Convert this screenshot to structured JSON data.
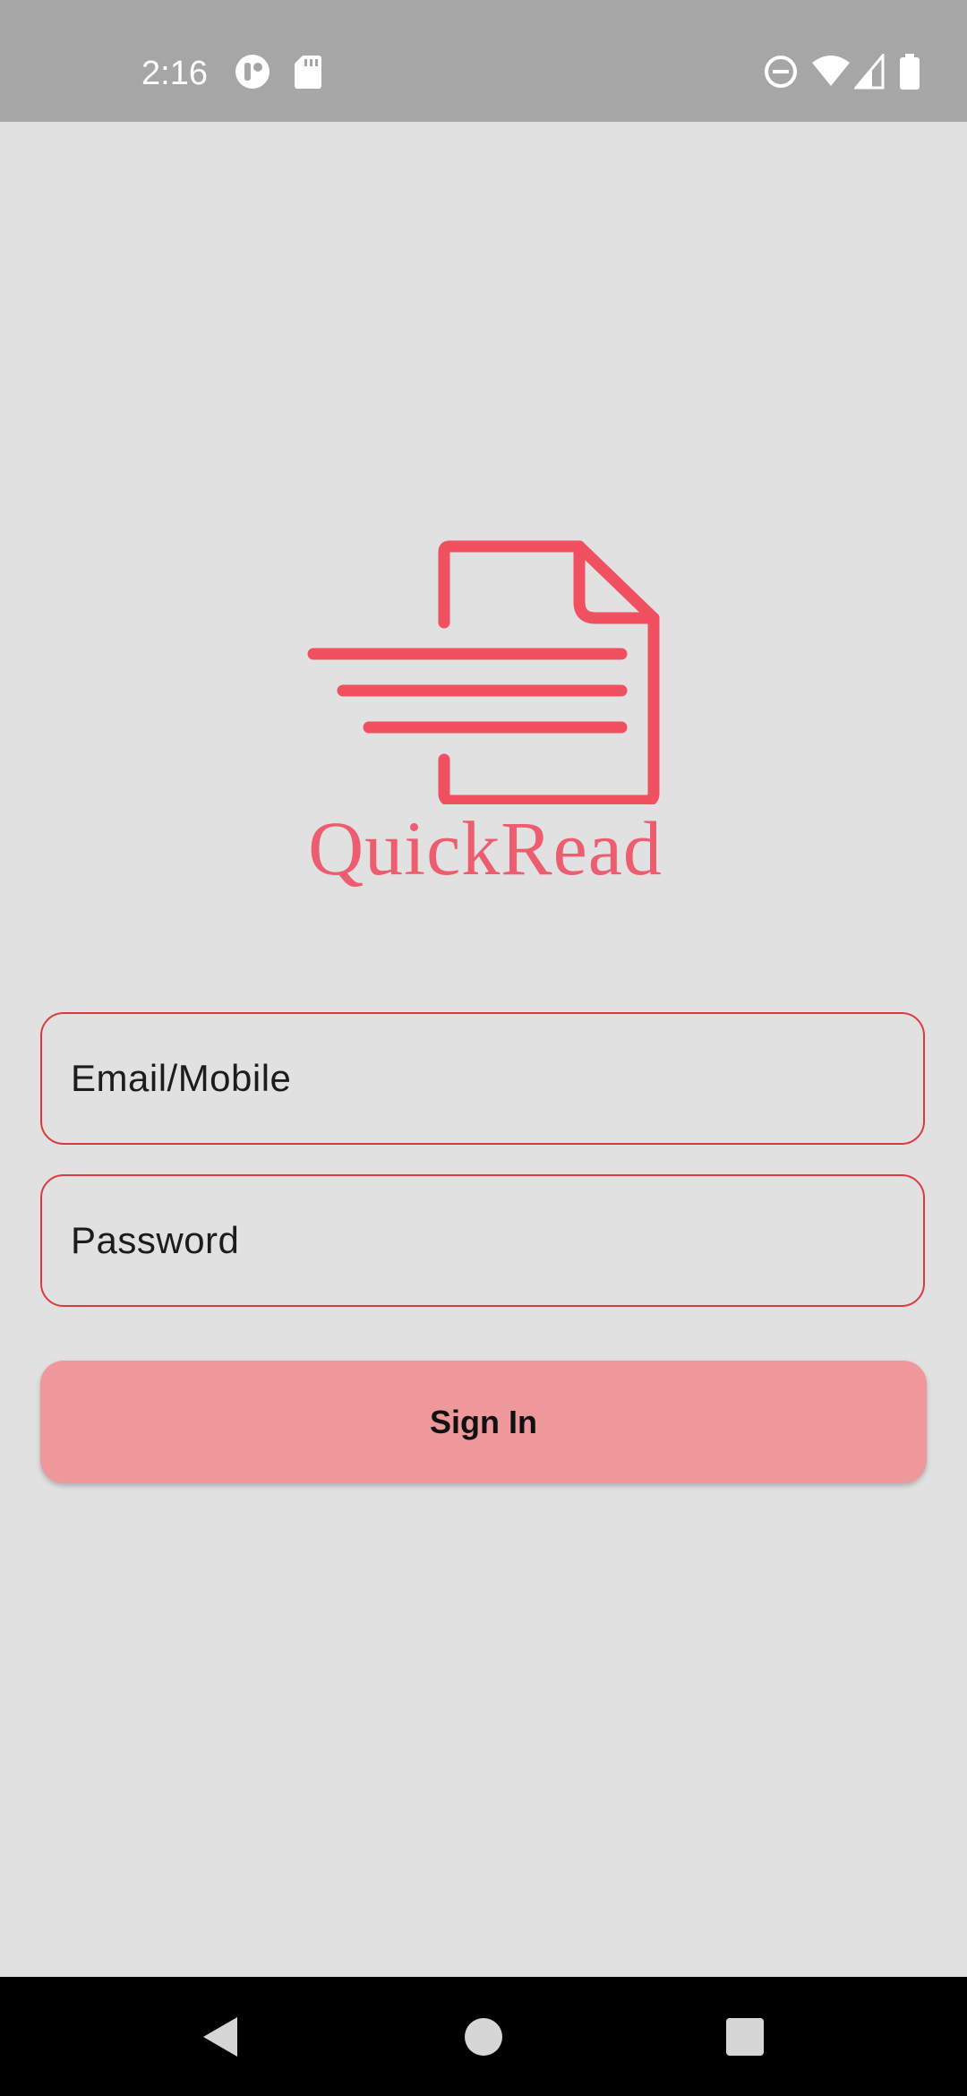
{
  "status_bar": {
    "time": "2:16",
    "left_icons": [
      "app-notification-icon",
      "sd-card-icon"
    ],
    "right_icons": [
      "do-not-disturb-icon",
      "wifi-icon",
      "cellular-signal-icon",
      "battery-icon"
    ]
  },
  "branding": {
    "app_name": "QuickRead",
    "logo_icon": "document-fast-icon",
    "brand_color": "#f0505f"
  },
  "form": {
    "email": {
      "value": "",
      "placeholder": "Email/Mobile"
    },
    "password": {
      "value": "",
      "placeholder": "Password"
    },
    "sign_in_label": "Sign In",
    "field_border_color": "#dc3a3f",
    "button_color": "#ef989b"
  },
  "nav_bar": {
    "buttons": [
      "back-icon",
      "home-icon",
      "recents-icon"
    ]
  }
}
